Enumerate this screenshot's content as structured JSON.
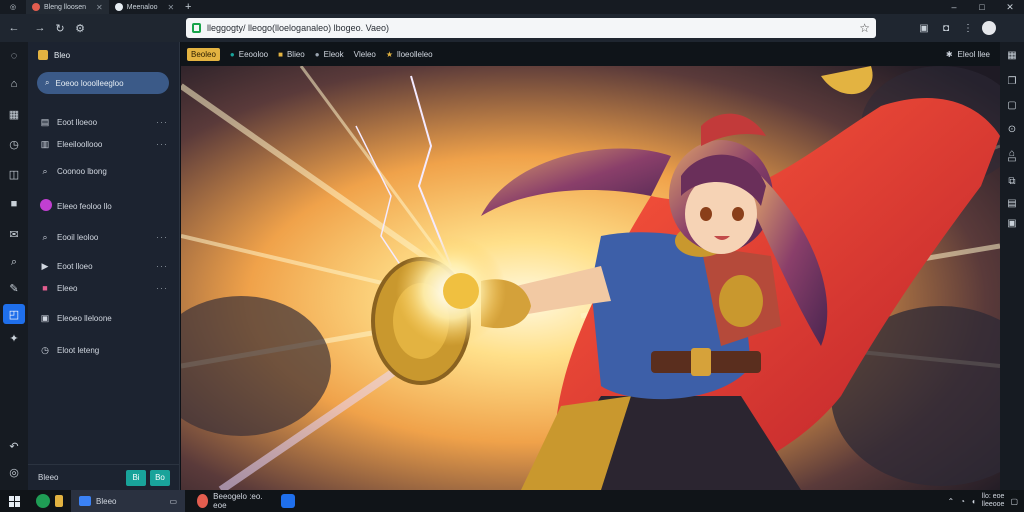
{
  "browser": {
    "tabs": [
      {
        "label": "Bleng lloosen",
        "color": "#e35d4f",
        "active": true
      },
      {
        "label": "Meenaloo",
        "color": "#e6edf3",
        "active": false
      }
    ],
    "new_tab": "+",
    "url": "lleggogty/ lleogo(lloeloganaleo) lbogeo. Vaeo)",
    "window_controls": {
      "minimize": "–",
      "maximize": "□",
      "close": "✕"
    }
  },
  "sidebar": {
    "title": "Bleo",
    "search_label": "Eoeoo looolleegloo",
    "items": [
      {
        "icon": "book-icon",
        "label": "Eoot lloeoo",
        "more": "···"
      },
      {
        "icon": "list-icon",
        "label": "Eleeiloollooo",
        "more": "···"
      },
      {
        "icon": "search-icon",
        "label": "Coonoo lbong",
        "more": ""
      },
      {
        "icon": "magenta-circle-icon",
        "label": "Eleeo feoloo llo",
        "more": ""
      },
      {
        "icon": "search-icon",
        "label": "Eooil leoloo",
        "more": "···"
      },
      {
        "icon": "play-icon",
        "label": "Eoot lloeo",
        "more": "···"
      },
      {
        "icon": "tag-icon",
        "label": "Eleeo",
        "more": "···"
      },
      {
        "icon": "document-icon",
        "label": "Eleoeo lleloone",
        "more": ""
      },
      {
        "icon": "clock-icon",
        "label": "Eloot leteng",
        "more": ""
      }
    ],
    "footer_label": "Bleeo",
    "footer_buttons": [
      "Bi",
      "Bo"
    ]
  },
  "content_header": {
    "chip": "Beoleo",
    "items": [
      "Eeooloo",
      "Blieo",
      "Eleok",
      "Vleleo",
      "lloeolleleo"
    ],
    "right_label": "Eleol llee"
  },
  "taskbar": {
    "apps": [
      {
        "label": "",
        "color": "#1f9d55"
      },
      {
        "label": "Bleeo",
        "color": "#e3b341",
        "active": true
      },
      {
        "label": "Beeogelo :eo. eoe",
        "color": "#e35d4f",
        "active": false
      },
      {
        "label": "",
        "color": "#1f6feb"
      }
    ],
    "clock_time": "llo: eoe",
    "clock_date": "lleeooe"
  },
  "colors": {
    "accent": "#1f6feb",
    "chip": "#e3b341",
    "teal": "#19a39a",
    "lock": "#17a34a"
  }
}
